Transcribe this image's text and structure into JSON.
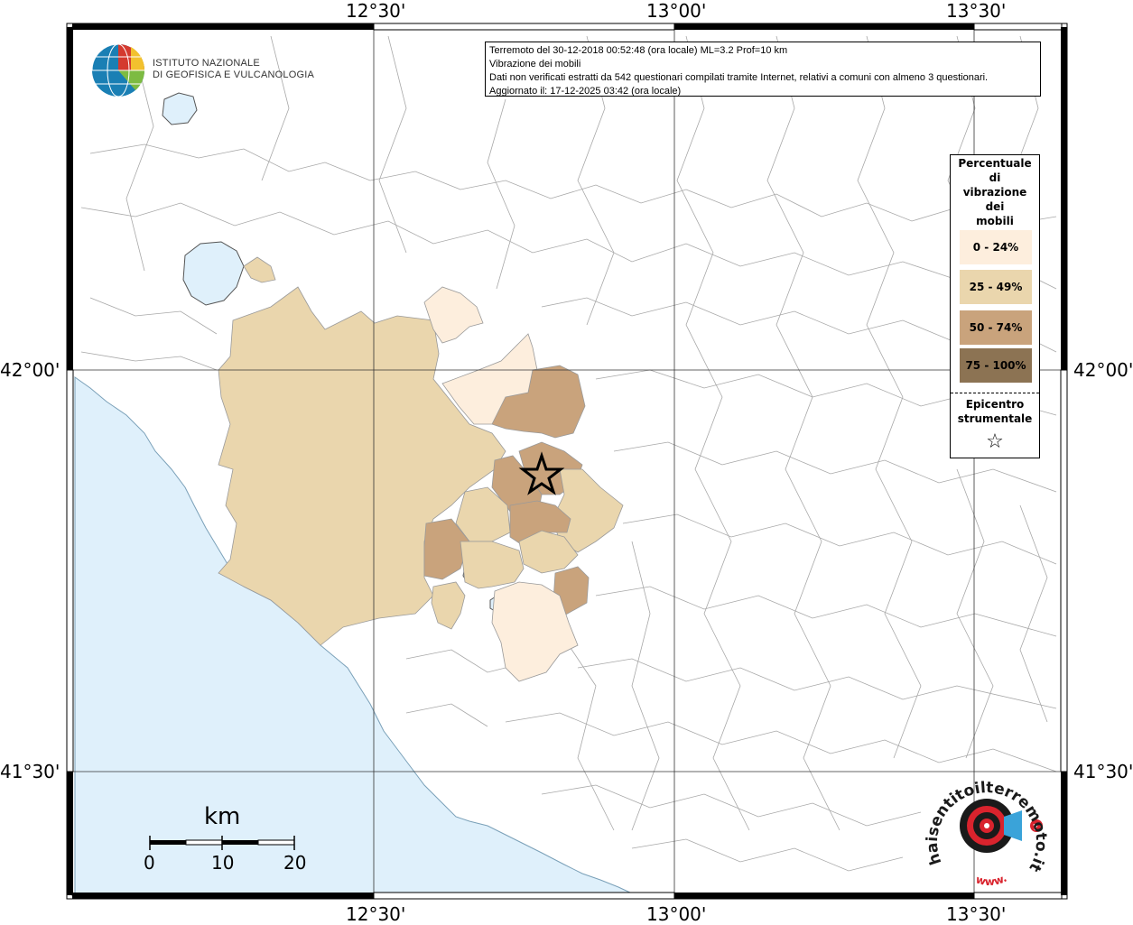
{
  "info": {
    "line1": "Terremoto del 30-12-2018 00:52:48 (ora locale) ML=3.2 Prof=10 km",
    "line2": "Vibrazione dei mobili",
    "line3": "Dati non verificati estratti da 542 questionari compilati tramite Internet, relativi a comuni con almeno 3 questionari.",
    "line4": "Aggiornato il: 17-12-2025 03:42 (ora locale)"
  },
  "logo": {
    "line1": "ISTITUTO NAZIONALE",
    "line2": "DI GEOFISICA E VULCANOLOGIA"
  },
  "coords": {
    "top": [
      "12°30'",
      "13°00'",
      "13°30'"
    ],
    "bottom": [
      "12°30'",
      "13°00'",
      "13°30'"
    ],
    "left": [
      "42°00'",
      "41°30'"
    ],
    "right": [
      "42°00'",
      "41°30'"
    ]
  },
  "legend": {
    "title_lines": [
      "Percentuale",
      "di",
      "vibrazione",
      "dei",
      "mobili"
    ],
    "items": [
      {
        "label": "0 - 24%",
        "color": "#fdeedd"
      },
      {
        "label": "25 - 49%",
        "color": "#ead6ad"
      },
      {
        "label": "50 - 74%",
        "color": "#c9a37c"
      },
      {
        "label": "75 - 100%",
        "color": "#8c7353"
      }
    ],
    "epicenter_line1": "Epicentro",
    "epicenter_line2": "strumentale",
    "star": "☆"
  },
  "scale": {
    "unit": "km",
    "ticks": [
      "0",
      "10",
      "20"
    ]
  },
  "stamp": {
    "text": "haisentitoilterremoto.it",
    "text2": "www."
  },
  "colors": {
    "sea": "#dff0fb",
    "land": "#ffffff",
    "border": "#a0a0a0"
  }
}
